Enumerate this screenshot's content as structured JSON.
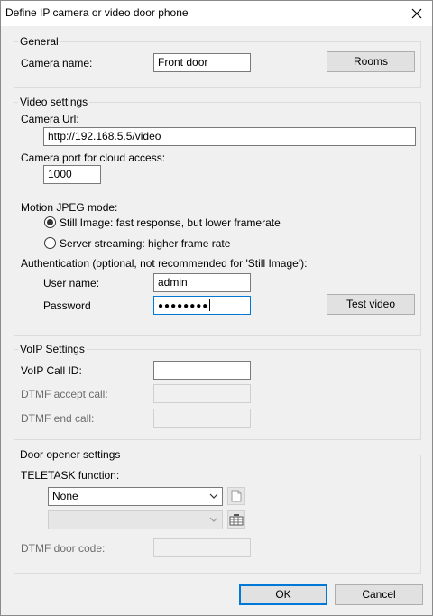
{
  "window": {
    "title": "Define IP camera or video door phone"
  },
  "general": {
    "title": "General",
    "camera_name_label": "Camera name:",
    "camera_name_value": "Front door",
    "rooms_button": "Rooms"
  },
  "video": {
    "title": "Video settings",
    "camera_url_label": "Camera Url:",
    "camera_url_value": "http://192.168.5.5/video",
    "cloud_port_label": "Camera port for cloud access:",
    "cloud_port_value": "1000",
    "mjpeg_label": "Motion JPEG mode:",
    "radio_still": "Still Image: fast response, but lower framerate",
    "radio_streaming": "Server streaming: higher frame rate",
    "selected_mode": "still",
    "auth_label": "Authentication (optional, not recommended for 'Still Image'):",
    "username_label": "User name:",
    "username_value": "admin",
    "password_label": "Password",
    "password_mask": "●●●●●●●●",
    "test_video_button": "Test video"
  },
  "voip": {
    "title": "VoIP Settings",
    "call_id_label": "VoIP Call ID:",
    "call_id_value": "",
    "dtmf_accept_label": "DTMF accept call:",
    "dtmf_accept_value": "",
    "dtmf_end_label": "DTMF end call:",
    "dtmf_end_value": ""
  },
  "door": {
    "title": "Door opener settings",
    "teletask_label": "TELETASK function:",
    "function_selected": "None",
    "secondary_selected": "",
    "dtmf_door_label": "DTMF door code:",
    "dtmf_door_value": ""
  },
  "footer": {
    "ok_button": "OK",
    "cancel_button": "Cancel"
  },
  "colors": {
    "accent": "#0078d7",
    "window_bg": "#f0f0f0",
    "titlebar_bg": "#ffffff"
  }
}
